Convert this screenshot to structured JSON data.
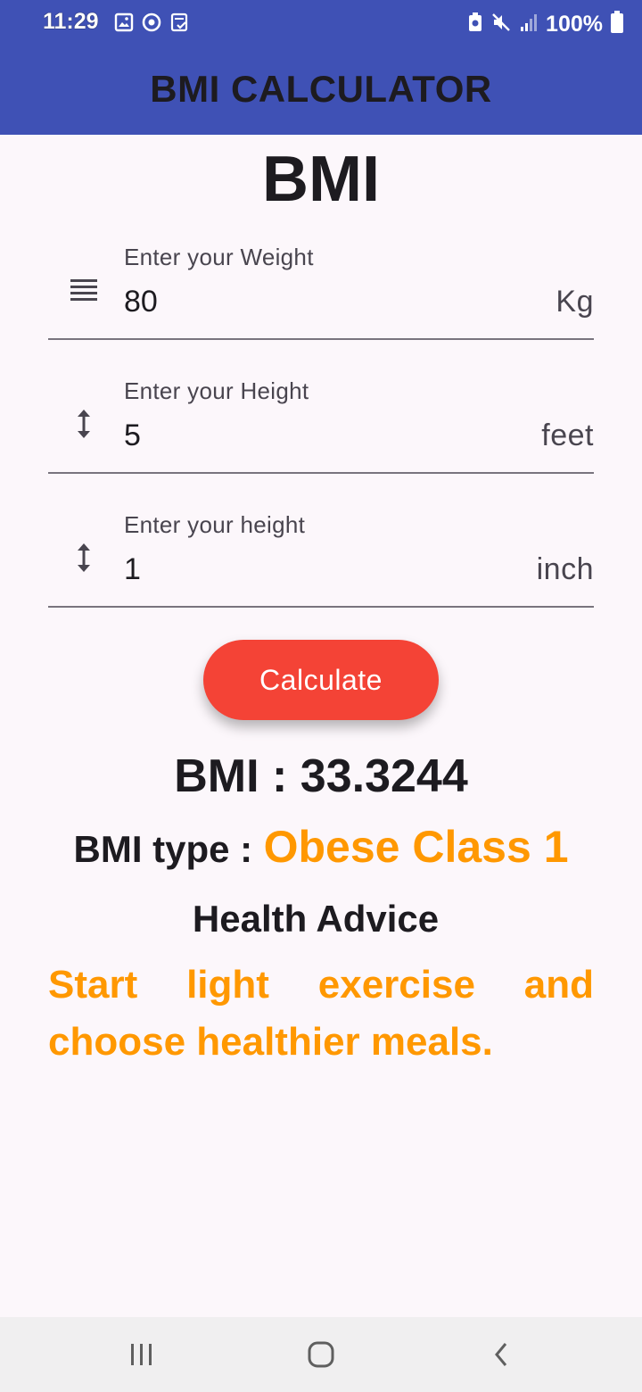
{
  "status_bar": {
    "time": "11:29",
    "battery": "100%",
    "icons_left": [
      "gallery-icon",
      "sync-icon",
      "clipboard-check-icon"
    ],
    "icons_right": [
      "recycle-battery-icon",
      "mute-icon",
      "signal-icon",
      "battery-icon"
    ]
  },
  "app_bar": {
    "title": "BMI CALCULATOR",
    "color": "#3f51b5"
  },
  "page_title": "BMI",
  "fields": {
    "weight": {
      "label": "Enter your Weight",
      "value": "80",
      "suffix": "Kg",
      "icon": "menu-lines-icon"
    },
    "height_feet": {
      "label": "Enter your Height",
      "value": "5",
      "suffix": "feet",
      "icon": "vertical-arrows-icon"
    },
    "height_inch": {
      "label": "Enter your height",
      "value": "1",
      "suffix": "inch",
      "icon": "vertical-arrows-icon"
    }
  },
  "calculate_button": {
    "label": "Calculate",
    "color": "#f44336"
  },
  "result": {
    "bmi_text": "BMI : 33.3244",
    "type_label": "BMI type :",
    "type_value": "Obese Class 1",
    "accent_color": "#ff9800"
  },
  "advice": {
    "heading": "Health Advice",
    "text": "Start light exercise and choose healthier meals."
  },
  "nav_bar": {
    "buttons": [
      "recents-icon",
      "home-icon",
      "back-icon"
    ]
  }
}
